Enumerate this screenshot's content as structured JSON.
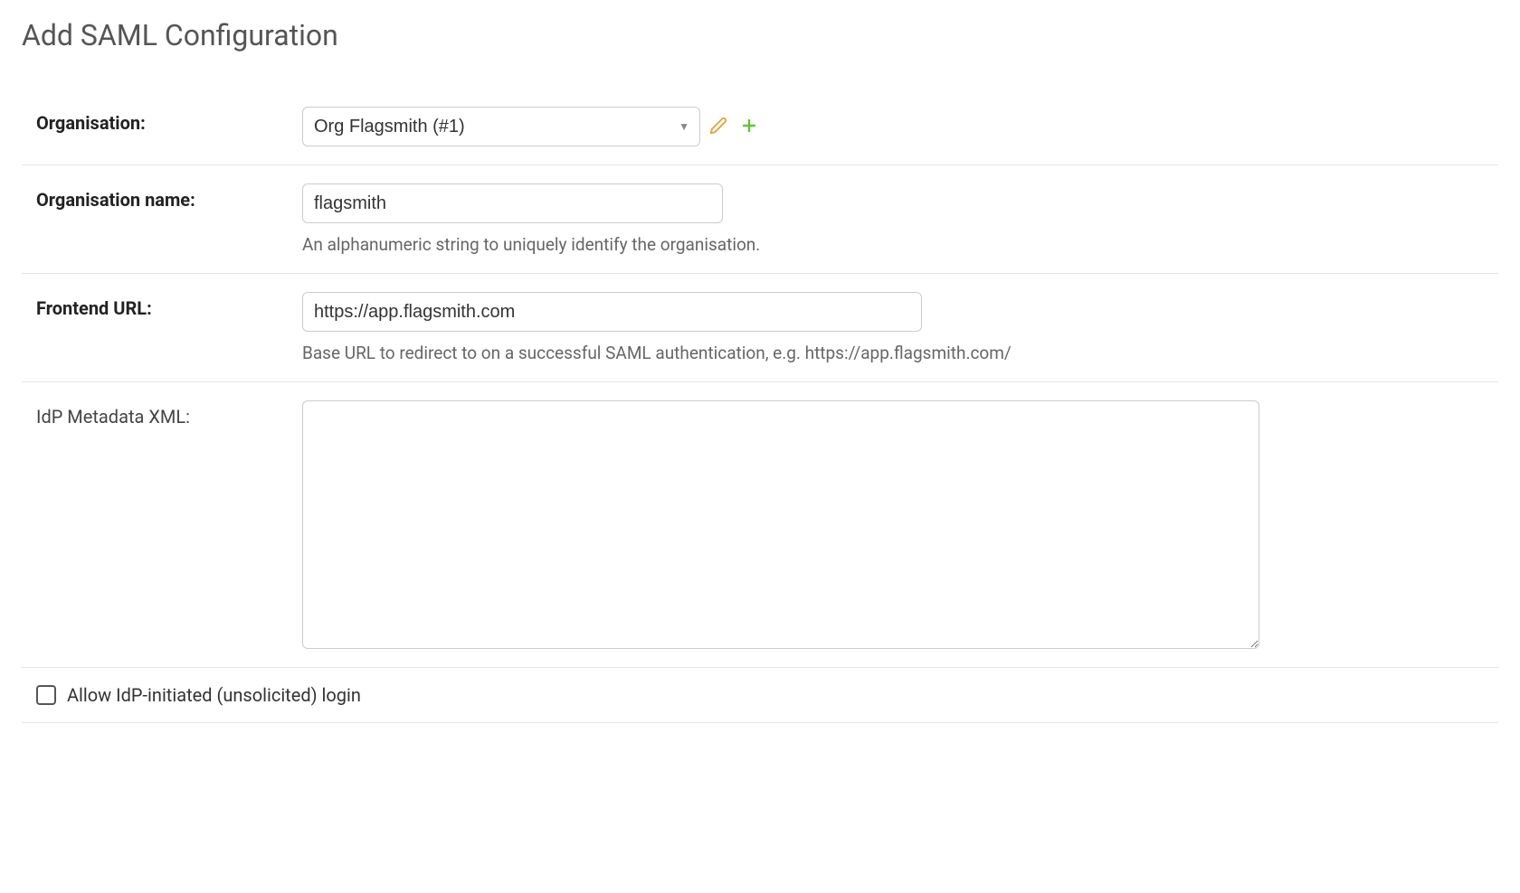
{
  "page": {
    "title": "Add SAML Configuration"
  },
  "form": {
    "organisation": {
      "label": "Organisation:",
      "selected": "Org Flagsmith (#1)"
    },
    "organisation_name": {
      "label": "Organisation name:",
      "value": "flagsmith",
      "help": "An alphanumeric string to uniquely identify the organisation."
    },
    "frontend_url": {
      "label": "Frontend URL:",
      "value": "https://app.flagsmith.com",
      "help": "Base URL to redirect to on a successful SAML authentication, e.g. https://app.flagsmith.com/"
    },
    "idp_metadata": {
      "label": "IdP Metadata XML:",
      "value": ""
    },
    "allow_idp_initiated": {
      "label": "Allow IdP-initiated (unsolicited) login",
      "checked": false
    }
  },
  "icons": {
    "edit": "pencil-icon",
    "add": "plus-icon"
  },
  "colors": {
    "edit_icon": "#e6a23c",
    "add_icon": "#67c23a",
    "border": "#e5e5e5"
  }
}
